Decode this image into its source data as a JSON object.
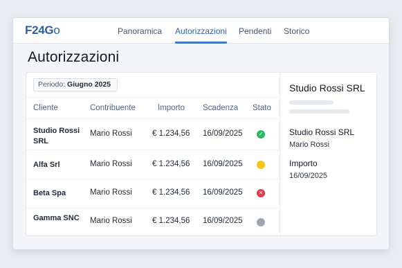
{
  "app": {
    "logo_main": "F24G",
    "logo_tail": "o"
  },
  "nav": {
    "tabs": [
      {
        "label": "Panoramica",
        "active": false
      },
      {
        "label": "Autorizzazioni",
        "active": true
      },
      {
        "label": "Pendenti",
        "active": false
      },
      {
        "label": "Storico",
        "active": false
      }
    ]
  },
  "page": {
    "title": "Autorizzazioni"
  },
  "filter": {
    "period_label": "Periodo:",
    "period_value": "Giugno 2025"
  },
  "table": {
    "columns": [
      "Cliente",
      "Contribuente",
      "Importo",
      "Scadenza",
      "Stato"
    ],
    "rows": [
      {
        "cliente": "Studio Rossi SRL",
        "contribuente": "Mario Rossi",
        "importo": "€ 1.234,56",
        "scadenza": "16/09/2025",
        "stato": "approved",
        "status_color": "#2fb864",
        "status_icon": "check-icon"
      },
      {
        "cliente": "Alfa Srl",
        "contribuente": "Mario Rossi",
        "importo": "€ 1.234,56",
        "scadenza": "16/09/2025",
        "stato": "pending",
        "status_color": "#f5c518",
        "status_icon": "dot-icon"
      },
      {
        "cliente": "Beta Spa",
        "contribuente": "Mario Rossi",
        "importo": "€ 1.234,56",
        "scadenza": "16/09/2025",
        "stato": "rejected",
        "status_color": "#e0394a",
        "status_icon": "cross-icon"
      },
      {
        "cliente": "Gamma SNC",
        "contribuente": "Mario Rossi",
        "importo": "€ 1.234,56",
        "scadenza": "16/09/2025",
        "stato": "inactive",
        "status_color": "#9aa7b5",
        "status_icon": "dot-icon"
      }
    ]
  },
  "detail": {
    "title": "Studio Rossi SRL",
    "client_label": "Studio Rossi SRL",
    "client_value": "Mario Rossi",
    "amount_label": "Importo",
    "amount_value": "16/09/2025"
  },
  "colors": {
    "brand": "#2a5fa8",
    "accent": "#3e78c6"
  }
}
